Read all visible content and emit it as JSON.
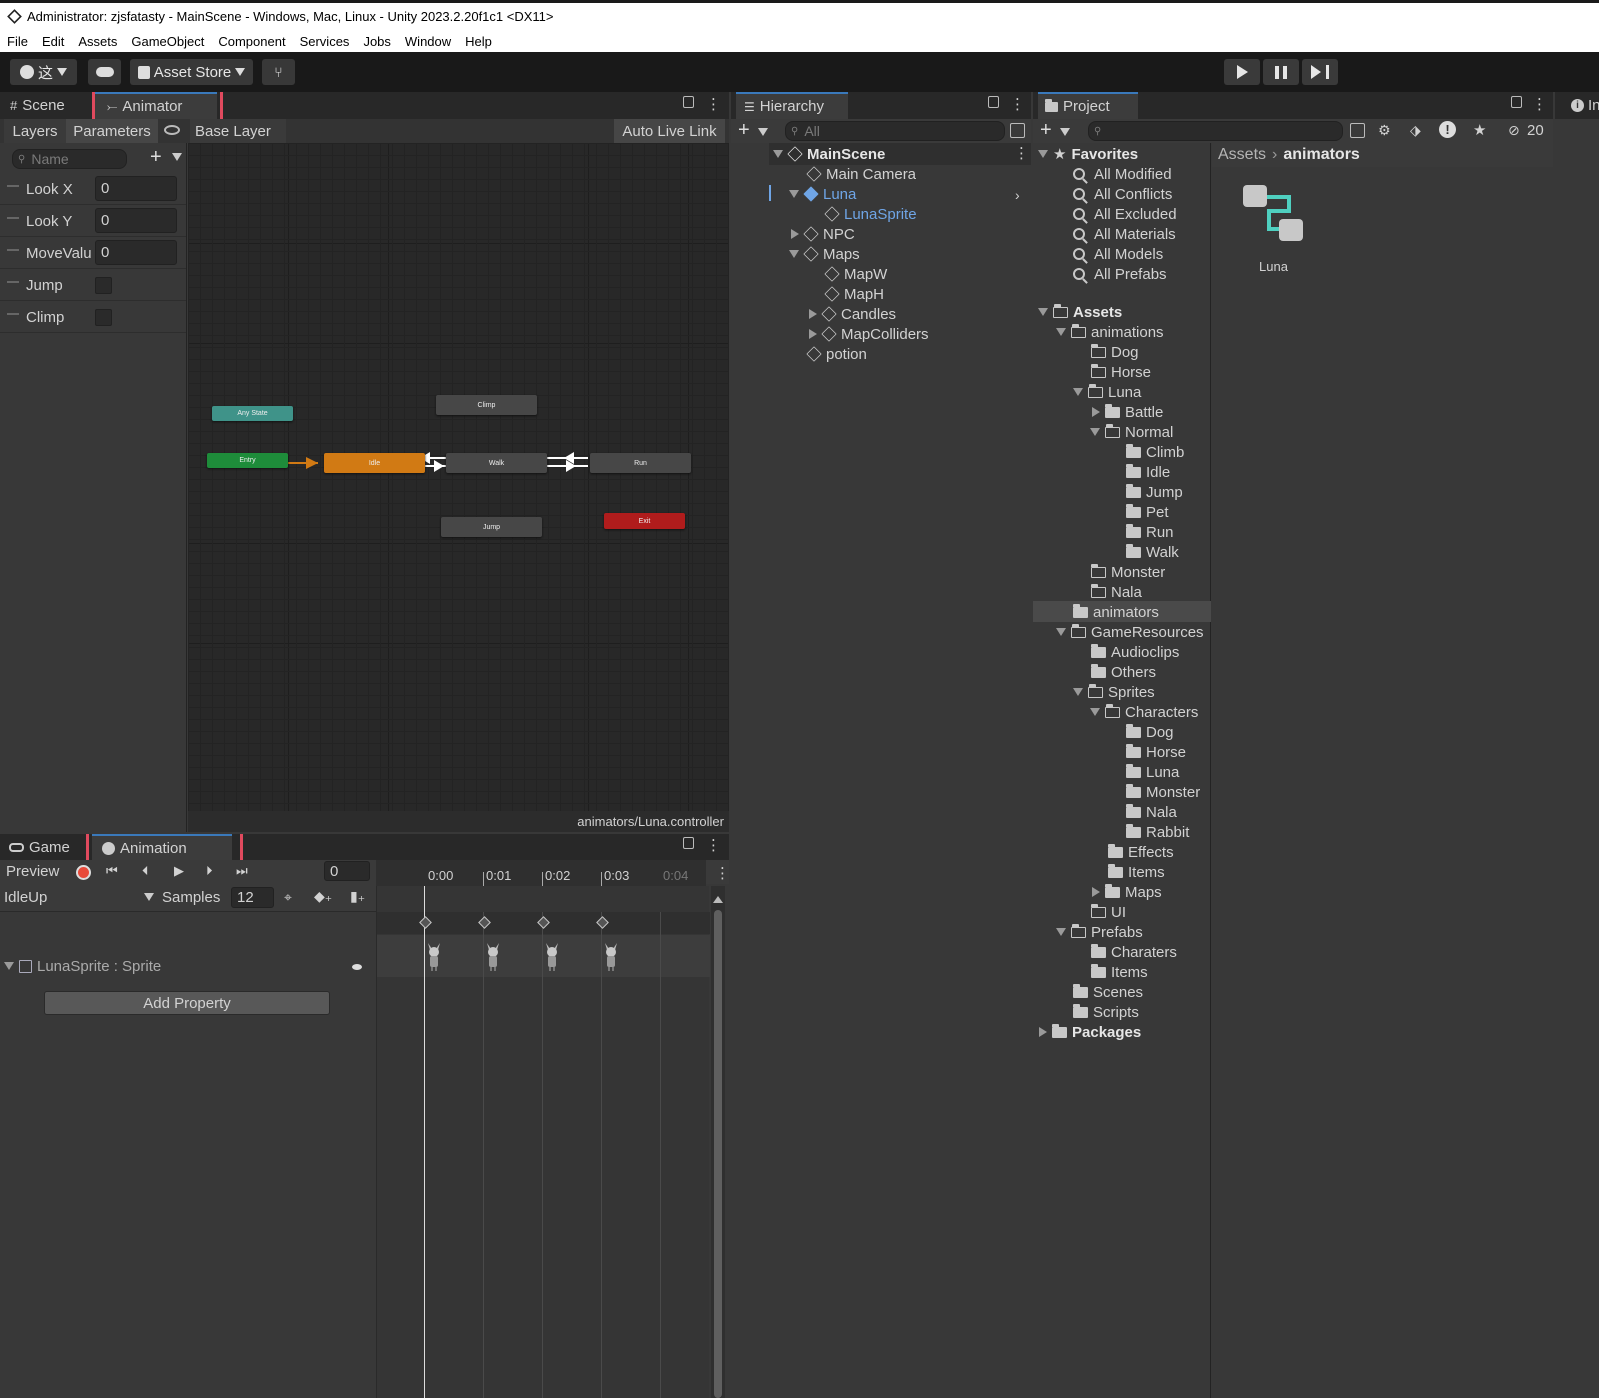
{
  "window": {
    "title": "Administrator: zjsfatasty - MainScene - Windows, Mac, Linux - Unity 2023.2.20f1c1 <DX11>"
  },
  "menu": [
    "File",
    "Edit",
    "Assets",
    "GameObject",
    "Component",
    "Services",
    "Jobs",
    "Window",
    "Help"
  ],
  "toolbar": {
    "account_char": "这",
    "asset_store": "Asset Store"
  },
  "animator_panel": {
    "tabs": [
      "Scene",
      "Animator"
    ],
    "subtabs": {
      "layers": "Layers",
      "parameters": "Parameters",
      "base_layer": "Base Layer",
      "auto_live_link": "Auto Live Link"
    },
    "search_placeholder": "Name",
    "params": [
      {
        "name": "Look X",
        "value": "0"
      },
      {
        "name": "Look Y",
        "value": "0"
      },
      {
        "name": "MoveValu",
        "value": "0"
      },
      {
        "name": "Jump",
        "value": ""
      },
      {
        "name": "Climp",
        "value": ""
      }
    ],
    "nodes": {
      "any_state": "Any State",
      "entry": "Entry",
      "idle": "Idle",
      "walk": "Walk",
      "run": "Run",
      "climp": "Climp",
      "jump": "Jump",
      "exit": "Exit"
    },
    "footer_path": "animators/Luna.controller"
  },
  "animation_panel": {
    "tabs": [
      "Game",
      "Animation"
    ],
    "preview": "Preview",
    "frame": "0",
    "clip": "IdleUp",
    "samples_label": "Samples",
    "samples": "12",
    "timeline": [
      "0:00",
      "0:01",
      "0:02",
      "0:03",
      "0:04"
    ],
    "property": "LunaSprite : Sprite",
    "add_property": "Add Property"
  },
  "hierarchy": {
    "title": "Hierarchy",
    "search_placeholder": "All",
    "scene": "MainScene",
    "items": [
      "Main Camera",
      "Luna",
      "LunaSprite",
      "NPC",
      "Maps",
      "MapW",
      "MapH",
      "Candles",
      "MapColliders",
      "potion"
    ]
  },
  "project": {
    "title": "Project",
    "hidden_count": "20",
    "favorites_title": "Favorites",
    "favorites": [
      "All Modified",
      "All Conflicts",
      "All Excluded",
      "All Materials",
      "All Models",
      "All Prefabs"
    ],
    "assets_title": "Assets",
    "tree": [
      "animations",
      "Dog",
      "Horse",
      "Luna",
      "Battle",
      "Normal",
      "Climb",
      "Idle",
      "Jump",
      "Pet",
      "Run",
      "Walk",
      "Monster",
      "Nala",
      "animators",
      "GameResources",
      "Audioclips",
      "Others",
      "Sprites",
      "Characters",
      "Dog",
      "Horse",
      "Luna",
      "Monster",
      "Nala",
      "Rabbit",
      "Effects",
      "Items",
      "Maps",
      "UI",
      "Prefabs",
      "Charaters",
      "Items",
      "Scenes",
      "Scripts"
    ],
    "packages_title": "Packages",
    "breadcrumb": [
      "Assets",
      "animators"
    ],
    "asset_item": "Luna"
  },
  "inspector": {
    "title": "In"
  },
  "colors": {
    "accent": "#3a79bb",
    "highlight": "#e04a5e",
    "idle_node": "#d17a14",
    "entry_node": "#1e8c3a",
    "exit_node": "#b01c1c",
    "any_state_node": "#3f9389",
    "selected_blue": "#6fa5e6"
  }
}
